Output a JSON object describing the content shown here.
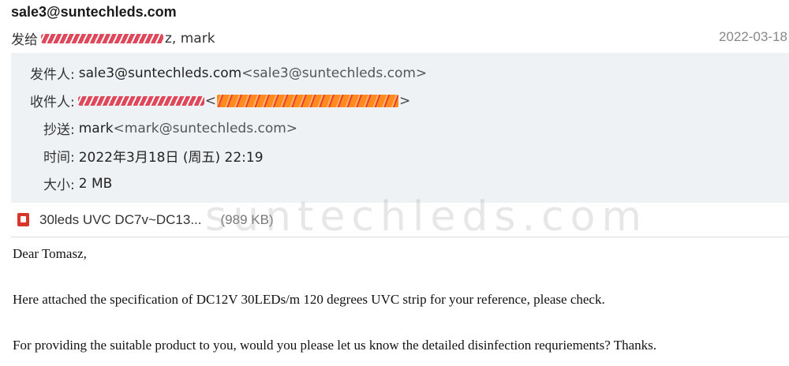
{
  "header": {
    "sender": "sale3@suntechleds.com",
    "to_prefix": "发给",
    "to_rest": "z, mark",
    "date": "2022-03-18"
  },
  "details": {
    "from_label": "发件人:",
    "from_name": "sale3@suntechleds.com",
    "from_email": "<sale3@suntechleds.com>",
    "to_label": "收件人:",
    "cc_label": "抄送:",
    "cc_name": "mark",
    "cc_email": "<mark@suntechleds.com>",
    "time_label": "时间:",
    "time_value": "2022年3月18日 (周五) 22:19",
    "size_label": "大小:",
    "size_value": "2 MB"
  },
  "attachment": {
    "icon": "pdf-icon",
    "name": "30leds UVC DC7v~DC13...",
    "size": "(989 KB)"
  },
  "watermark": "suntechleds.com",
  "body": {
    "greeting": "Dear Tomasz,",
    "line1": "Here attached the specification of DC12V 30LEDs/m 120 degrees UVC strip for your reference, please check.",
    "line2": "For providing the suitable product to you, would you please let us know the detailed disinfection requriements? Thanks."
  },
  "colors": {
    "details_bg": "#eef2f5",
    "pdf_red": "#d9362b",
    "redaction_red": "#e24a5a",
    "redaction_orange": "#ff8a1e"
  }
}
